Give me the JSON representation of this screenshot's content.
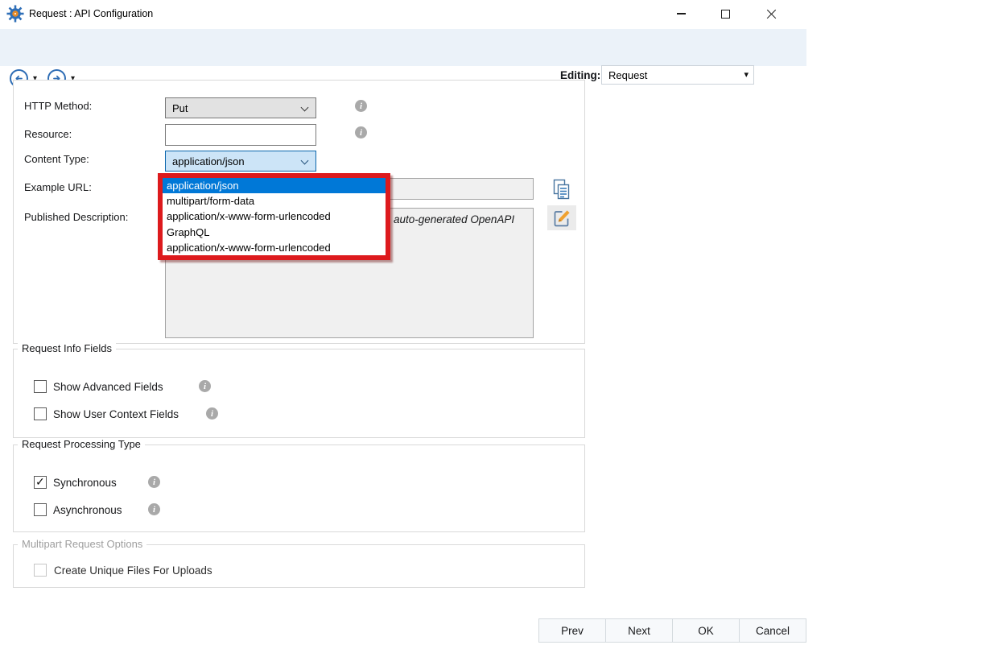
{
  "window": {
    "title": "Request : API Configuration"
  },
  "toolbar": {
    "editing_label": "Editing:",
    "editing_value": "Request"
  },
  "form": {
    "http_method_label": "HTTP Method:",
    "http_method_value": "Put",
    "resource_label": "Resource:",
    "resource_value": "",
    "content_type_label": "Content Type:",
    "content_type_value": "application/json",
    "example_url_label": "Example URL:",
    "example_url_value": "",
    "published_description_label": "Published Description:",
    "published_description_visible_text": "auto-generated OpenAPI"
  },
  "content_type_dropdown": {
    "selected_index": 0,
    "options": [
      "application/json",
      "multipart/form-data",
      "application/x-www-form-urlencoded",
      "GraphQL",
      "application/x-www-form-urlencoded"
    ]
  },
  "request_info_fields": {
    "legend": "Request Info Fields",
    "show_advanced_label": "Show Advanced Fields",
    "show_advanced_checked": false,
    "show_user_context_label": "Show User Context Fields",
    "show_user_context_checked": false
  },
  "request_processing_type": {
    "legend": "Request Processing Type",
    "synchronous_label": "Synchronous",
    "synchronous_checked": true,
    "asynchronous_label": "Asynchronous",
    "asynchronous_checked": false
  },
  "multipart_request_options": {
    "legend": "Multipart Request Options",
    "disabled": true,
    "create_unique_label": "Create Unique Files For Uploads",
    "create_unique_checked": false
  },
  "footer_buttons": {
    "prev": "Prev",
    "next": "Next",
    "ok": "OK",
    "cancel": "Cancel"
  },
  "icons": {
    "app": "gear-icon",
    "back": "circle-arrow-left-icon",
    "forward": "circle-arrow-right-icon",
    "caret": "▾",
    "info": "i",
    "copy": "copy-pages-icon",
    "edit": "edit-pencil-icon"
  },
  "colors": {
    "toolbar_bg": "#ebf2f9",
    "selection_blue": "#0078d7",
    "focused_combo_bg": "#cce4f7",
    "focused_combo_border": "#0b66ad",
    "annotation_red": "#dd1a1d",
    "accent_blue": "#2e6db5",
    "readonly_bg": "#f0f0f0"
  }
}
